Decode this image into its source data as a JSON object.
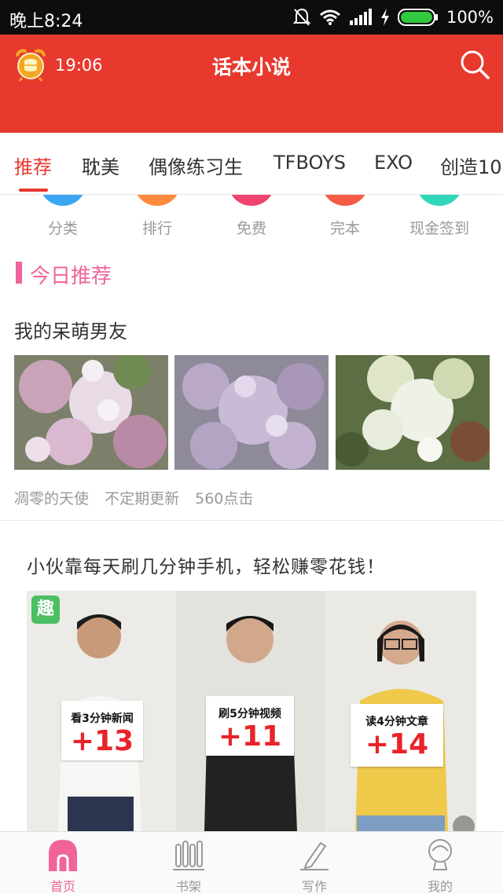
{
  "status_bar": {
    "time": "晚上8:24",
    "battery_text": "100%",
    "icons": [
      "mute-bell-icon",
      "wifi-icon",
      "signal-icon",
      "charging-icon",
      "battery-icon"
    ]
  },
  "header": {
    "countdown": "19:06",
    "title": "话本小说",
    "accent": "#e8392e"
  },
  "tabs": [
    {
      "label": "推荐",
      "active": true
    },
    {
      "label": "耽美"
    },
    {
      "label": "偶像练习生"
    },
    {
      "label": "TFBOYS"
    },
    {
      "label": "EXO"
    },
    {
      "label": "创造10"
    }
  ],
  "quick_entries": [
    {
      "label": "分类",
      "color": "#3aa6f3"
    },
    {
      "label": "排行",
      "color": "#ff8a3d"
    },
    {
      "label": "免费",
      "color": "#f0436e"
    },
    {
      "label": "完本",
      "color": "#f55b45"
    },
    {
      "label": "现金签到",
      "color": "#2fd6b8"
    }
  ],
  "section": {
    "title": "今日推荐",
    "color": "#f0649a"
  },
  "book": {
    "title": "我的呆萌男友",
    "author": "凋零的天使",
    "update": "不定期更新",
    "clicks": "560点击"
  },
  "ad": {
    "title": "小伙靠每天刷几分钟手机，轻松赚零花钱！",
    "logo_text": "趣",
    "signs": [
      {
        "caption": "看3分钟新闻",
        "number": "+13"
      },
      {
        "caption": "刷5分钟视频",
        "number": "+11"
      },
      {
        "caption": "读4分钟文章",
        "number": "+14"
      }
    ]
  },
  "bottom_nav": [
    {
      "label": "首页",
      "icon": "home-icon",
      "active": true
    },
    {
      "label": "书架",
      "icon": "bookshelf-icon"
    },
    {
      "label": "写作",
      "icon": "pen-icon"
    },
    {
      "label": "我的",
      "icon": "profile-icon"
    }
  ]
}
